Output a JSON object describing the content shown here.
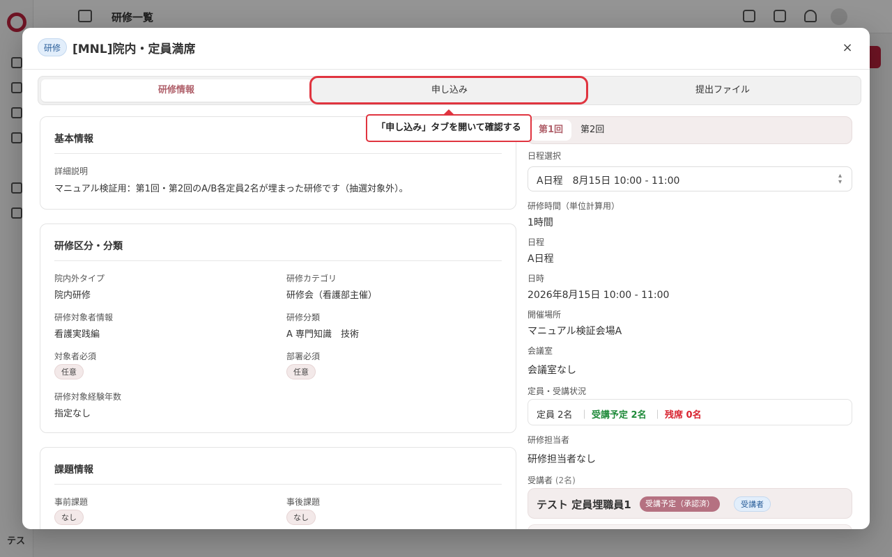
{
  "background": {
    "header_title": "研修一覧",
    "footer_user": "テス"
  },
  "modal": {
    "badge": "研修",
    "title": "[MNL]院内・定員満席",
    "close_icon": "×",
    "tabs": [
      {
        "label": "研修情報",
        "active": true
      },
      {
        "label": "申し込み",
        "active": false,
        "highlighted": true
      },
      {
        "label": "提出ファイル",
        "active": false
      }
    ],
    "callout": "「申し込み」タブを開いて確認する"
  },
  "basic_info": {
    "title": "基本情報",
    "detail_label": "詳細説明",
    "detail_value": "マニュアル検証用：第1回・第2回のA/B各定員2名が埋まった研修です（抽選対象外）。"
  },
  "classification": {
    "title": "研修区分・分類",
    "inout_label": "院内外タイプ",
    "inout_value": "院内研修",
    "category_label": "研修カテゴリ",
    "category_value": "研修会（看護部主催）",
    "target_label": "研修対象者情報",
    "target_value": "看護実践編",
    "class_label": "研修分類",
    "class_value": "A 専門知識　技術",
    "target_required_label": "対象者必須",
    "target_required_value": "任意",
    "dept_required_label": "部署必須",
    "dept_required_value": "任意",
    "years_label": "研修対象経験年数",
    "years_value": "指定なし"
  },
  "assignments": {
    "title": "課題情報",
    "pre_label": "事前課題",
    "pre_value": "なし",
    "post_label": "事後課題",
    "post_value": "なし"
  },
  "sessions": {
    "tabs": [
      {
        "label": "第1回",
        "active": true
      },
      {
        "label": "第2回",
        "active": false
      }
    ],
    "schedule_select_label": "日程選択",
    "schedule_select_value": "A日程　8月15日 10:00 - 11:00",
    "hours_label": "研修時間（単位計算用）",
    "hours_value": "1時間",
    "schedule_label": "日程",
    "schedule_value": "A日程",
    "datetime_label": "日時",
    "datetime_value": "2026年8月15日 10:00 - 11:00",
    "venue_label": "開催場所",
    "venue_value": "マニュアル検証会場A",
    "room_label": "会議室",
    "room_value": "会議室なし",
    "capacity_label": "定員・受講状況",
    "capacity_total": "定員 2名",
    "capacity_sep": "｜",
    "capacity_enrolled": "受講予定 2名",
    "capacity_remaining": "残席 0名",
    "capacity_colors": {
      "enrolled": "#1f8a3a",
      "remaining": "#d8232f"
    },
    "instructor_label": "研修担当者",
    "instructor_value": "研修担当者なし",
    "attendees_label": "受講者",
    "attendees_count": "(2名)",
    "attendees": [
      {
        "name": "テスト 定員埋職員1",
        "status": "受講予定（承認済）",
        "role": "受講者"
      }
    ]
  },
  "colors": {
    "accent": "#b0616b",
    "highlight": "#e0343f",
    "brand": "#c0243f"
  }
}
